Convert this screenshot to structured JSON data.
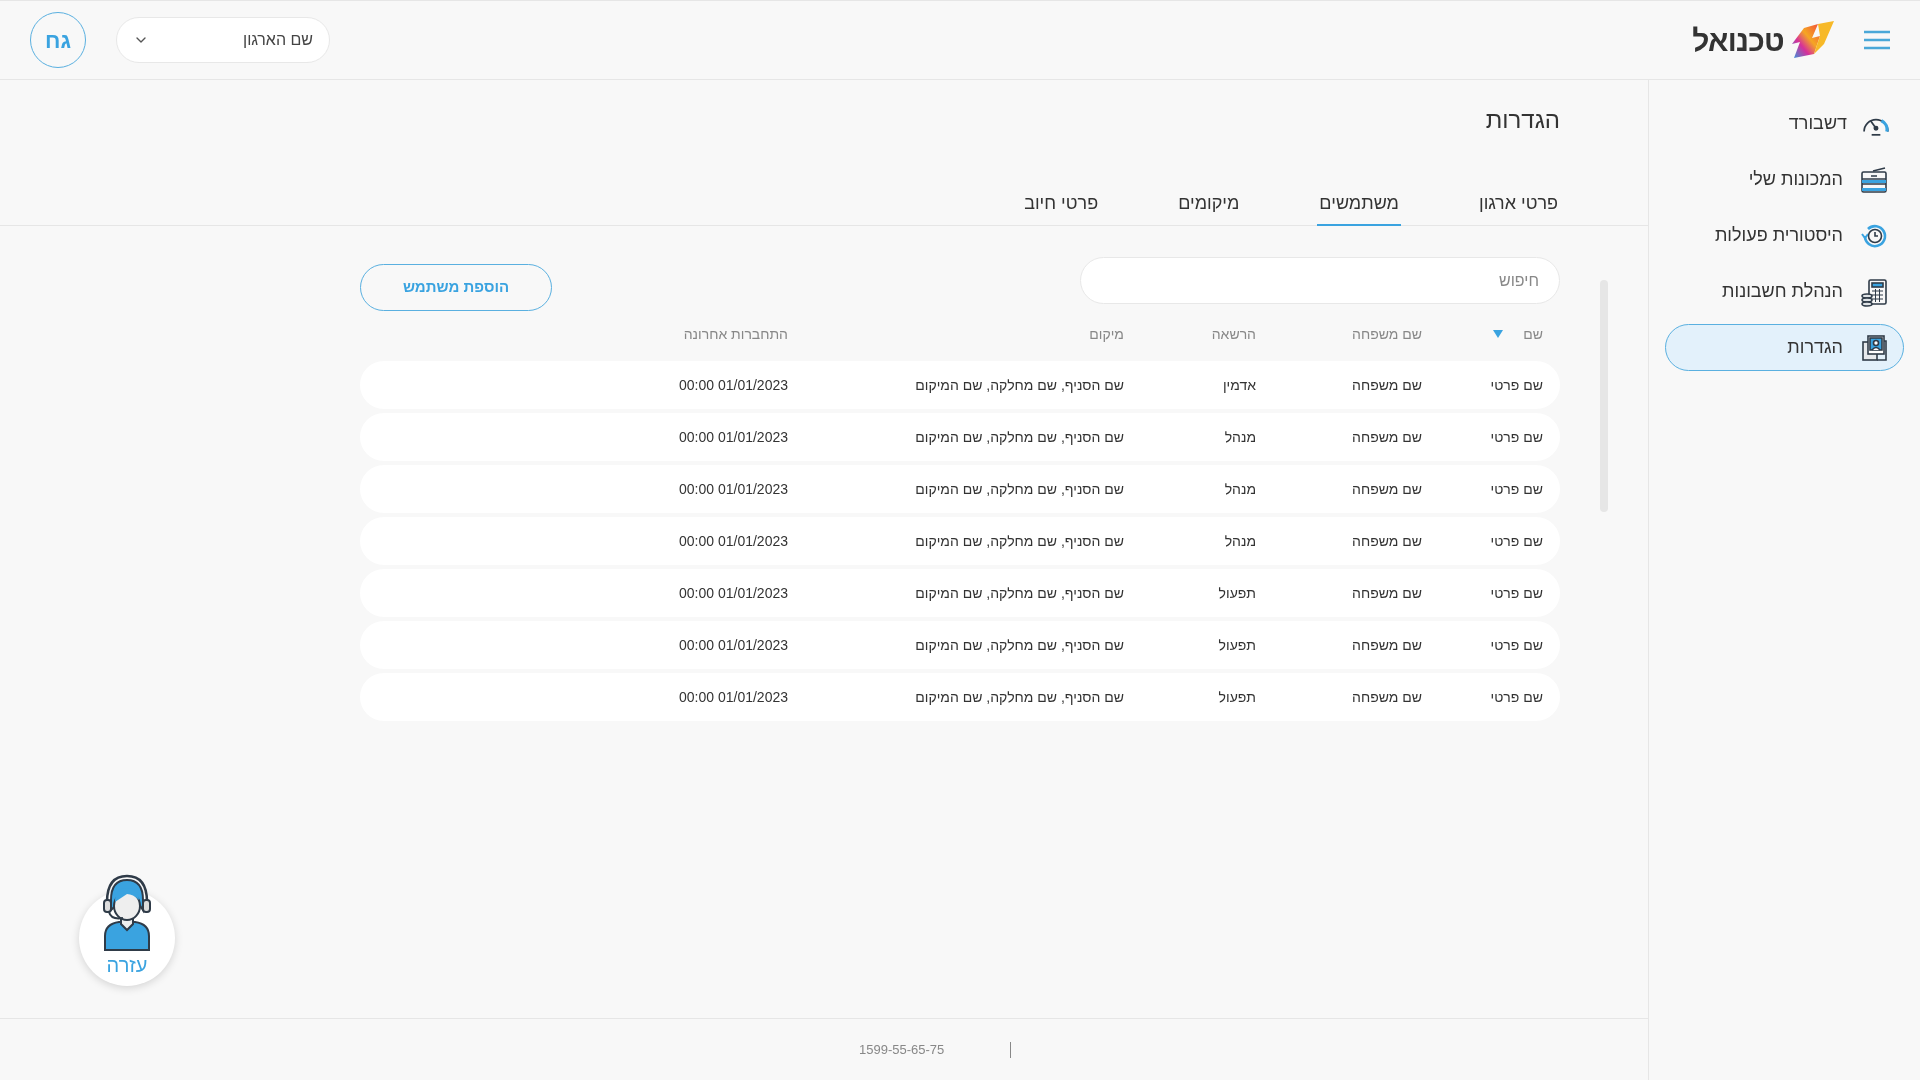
{
  "header": {
    "logo_text": "טכנואל",
    "org_select": {
      "value": "שם הארגון"
    },
    "avatar": "גח"
  },
  "sidebar": {
    "items": [
      {
        "label": "דשבורד",
        "kind": "gauge",
        "selected": false
      },
      {
        "label": "המכונות שלי",
        "kind": "machine",
        "selected": false
      },
      {
        "label": "היסטורית פעולות",
        "kind": "history",
        "selected": false
      },
      {
        "label": "הנהלת חשבונות",
        "kind": "calculator",
        "selected": false
      },
      {
        "label": "הגדרות",
        "kind": "profile",
        "selected": true
      }
    ]
  },
  "page": {
    "title": "הגדרות"
  },
  "tabs": [
    {
      "label": "פרטי ארגון",
      "selected": false
    },
    {
      "label": "משתמשים",
      "selected": true
    },
    {
      "label": "מיקומים",
      "selected": false
    },
    {
      "label": "פרטי חיוב",
      "selected": false
    }
  ],
  "search": {
    "placeholder": "חיפוש"
  },
  "add_button": "הוספת משתמש",
  "table": {
    "columns": [
      {
        "label": "שם",
        "sorted": true
      },
      {
        "label": "שם משפחה",
        "sorted": false
      },
      {
        "label": "הרשאה",
        "sorted": false
      },
      {
        "label": "מיקום",
        "sorted": false
      },
      {
        "label": "התחברות אחרונה",
        "sorted": false
      }
    ],
    "rows": [
      [
        "שם פרטי",
        "שם משפחה",
        "אדמין",
        "שם הסניף, שם מחלקה, שם המיקום",
        "00:00 01/01/2023"
      ],
      [
        "שם פרטי",
        "שם משפחה",
        "מנהל",
        "שם הסניף, שם מחלקה, שם המיקום",
        "00:00 01/01/2023"
      ],
      [
        "שם פרטי",
        "שם משפחה",
        "מנהל",
        "שם הסניף, שם מחלקה, שם המיקום",
        "00:00 01/01/2023"
      ],
      [
        "שם פרטי",
        "שם משפחה",
        "מנהל",
        "שם הסניף, שם מחלקה, שם המיקום",
        "00:00 01/01/2023"
      ],
      [
        "שם פרטי",
        "שם משפחה",
        "תפעול",
        "שם הסניף, שם מחלקה, שם המיקום",
        "00:00 01/01/2023"
      ],
      [
        "שם פרטי",
        "שם משפחה",
        "תפעול",
        "שם הסניף, שם מחלקה, שם המיקום",
        "00:00 01/01/2023"
      ],
      [
        "שם פרטי",
        "שם משפחה",
        "תפעול",
        "שם הסניף, שם מחלקה, שם המיקום",
        "00:00 01/01/2023"
      ]
    ]
  },
  "help": {
    "label": "עזרה"
  },
  "footer": {
    "phone": "1599-55-65-75"
  }
}
